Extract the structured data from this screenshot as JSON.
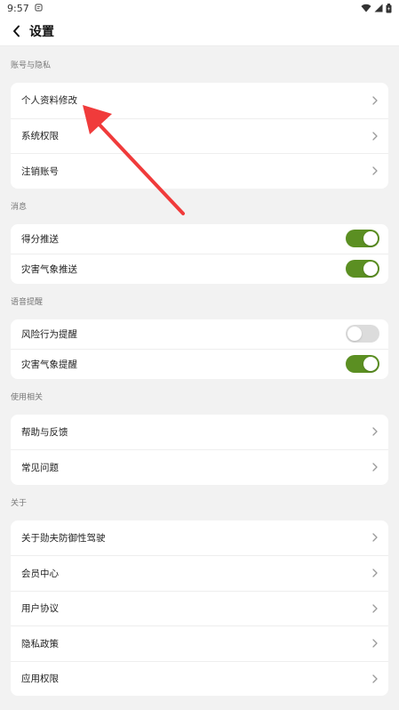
{
  "status_bar": {
    "time": "9:57"
  },
  "header": {
    "title": "设置"
  },
  "sections": {
    "account": {
      "label": "账号与隐私",
      "items": [
        "个人资料修改",
        "系统权限",
        "注销账号"
      ]
    },
    "messages": {
      "label": "消息",
      "items": [
        {
          "label": "得分推送",
          "enabled": true
        },
        {
          "label": "灾害气象推送",
          "enabled": true
        }
      ]
    },
    "voice": {
      "label": "语音提醒",
      "items": [
        {
          "label": "风险行为提醒",
          "enabled": false
        },
        {
          "label": "灾害气象提醒",
          "enabled": true
        }
      ]
    },
    "usage": {
      "label": "使用相关",
      "items": [
        "帮助与反馈",
        "常见问题"
      ]
    },
    "about": {
      "label": "关于",
      "items": [
        "关于勋夫防御性驾驶",
        "会员中心",
        "用户协议",
        "隐私政策",
        "应用权限"
      ]
    }
  },
  "colors": {
    "toggle_on": "#5b8f22",
    "toggle_off": "#dcdcdc",
    "annotation_arrow": "#f03b3b"
  }
}
